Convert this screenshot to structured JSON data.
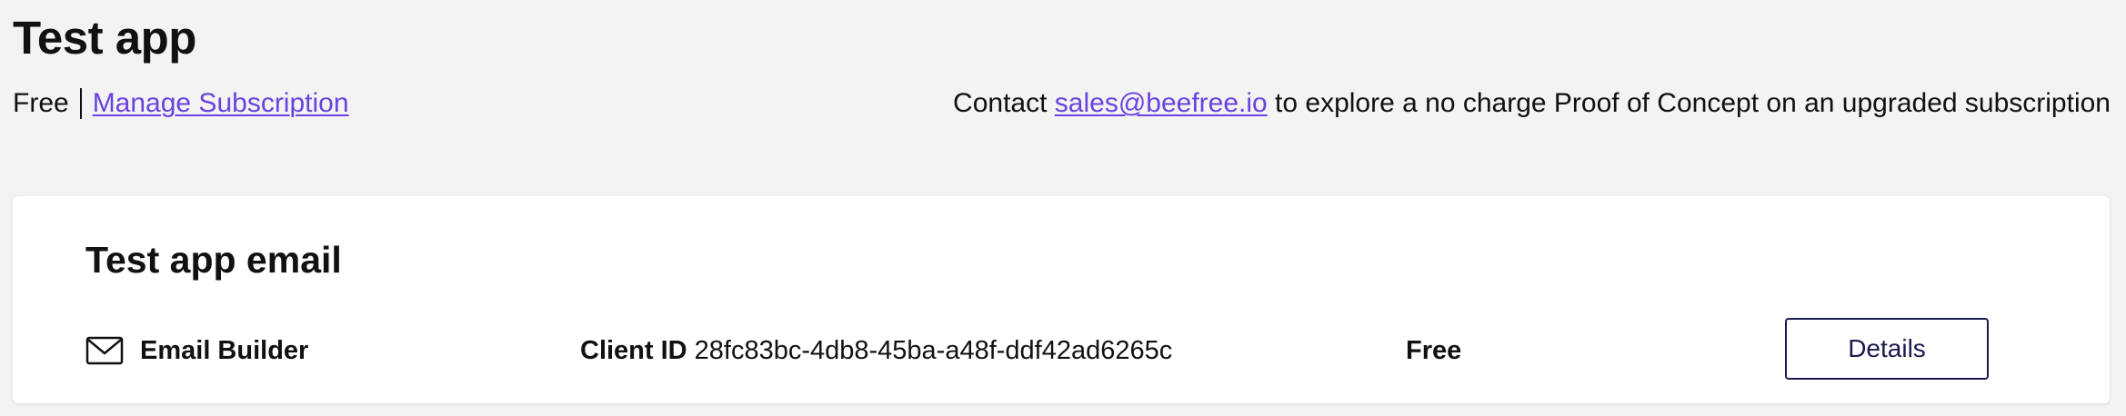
{
  "app": {
    "title": "Test app",
    "plan": "Free",
    "manage_link": "Manage Subscription"
  },
  "contact": {
    "prefix": "Contact",
    "email": "sales@beefree.io",
    "suffix": "to explore a no charge Proof of Concept on an upgraded subscription"
  },
  "card": {
    "title": "Test app email",
    "product": {
      "icon": "envelope-icon",
      "name": "Email Builder"
    },
    "client_id_label": "Client ID",
    "client_id_value": "28fc83bc-4db8-45ba-a48f-ddf42ad6265c",
    "plan": "Free",
    "details_label": "Details"
  },
  "colors": {
    "background": "#f3f3f3",
    "card": "#ffffff",
    "link": "#6a42e0",
    "button_border": "#1a1a4e"
  }
}
